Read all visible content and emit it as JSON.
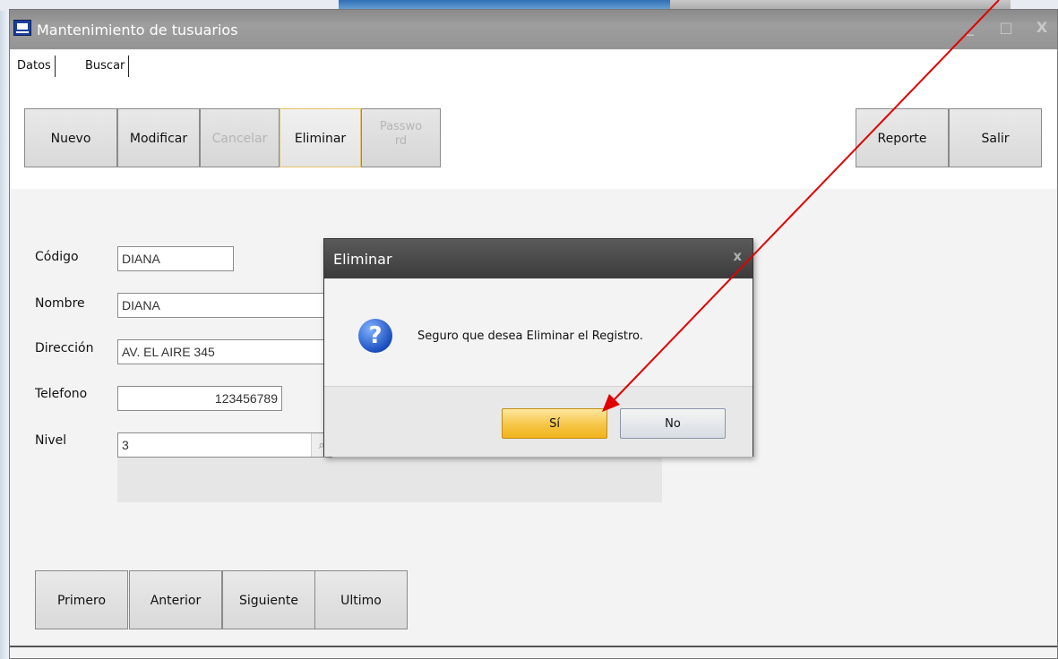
{
  "window": {
    "title": "Mantenimiento de tusuarios",
    "controls": [
      "_",
      "□",
      "X"
    ]
  },
  "tabs": [
    {
      "label": "Datos"
    },
    {
      "label": "Buscar"
    }
  ],
  "toolbar": {
    "nuevo": "Nuevo",
    "modificar": "Modificar",
    "cancelar": "Cancelar",
    "eliminar": "Eliminar",
    "password": "Password",
    "reporte": "Reporte",
    "salir": "Salir"
  },
  "form": {
    "codigo": {
      "label": "Código",
      "value": "DIANA"
    },
    "nombre": {
      "label": "Nombre",
      "value": "DIANA"
    },
    "direccion": {
      "label": "Dirección",
      "value": "AV. EL AIRE 345"
    },
    "telefono": {
      "label": "Telefono",
      "value": "123456789"
    },
    "nivel": {
      "label": "Nivel",
      "value": "3"
    }
  },
  "navigation": {
    "primero": "Primero",
    "anterior": "Anterior",
    "siguiente": "Siguiente",
    "ultimo": "Ultimo"
  },
  "dialog": {
    "title": "Eliminar",
    "close": "x",
    "message": "Seguro que desea Eliminar el Registro.",
    "icon": "question-icon",
    "yes_label": "Sí",
    "no_label": "No"
  },
  "colors": {
    "annotation_arrow": "#e00000",
    "yes_button": "#f6c546",
    "title_bar": "#949494"
  }
}
